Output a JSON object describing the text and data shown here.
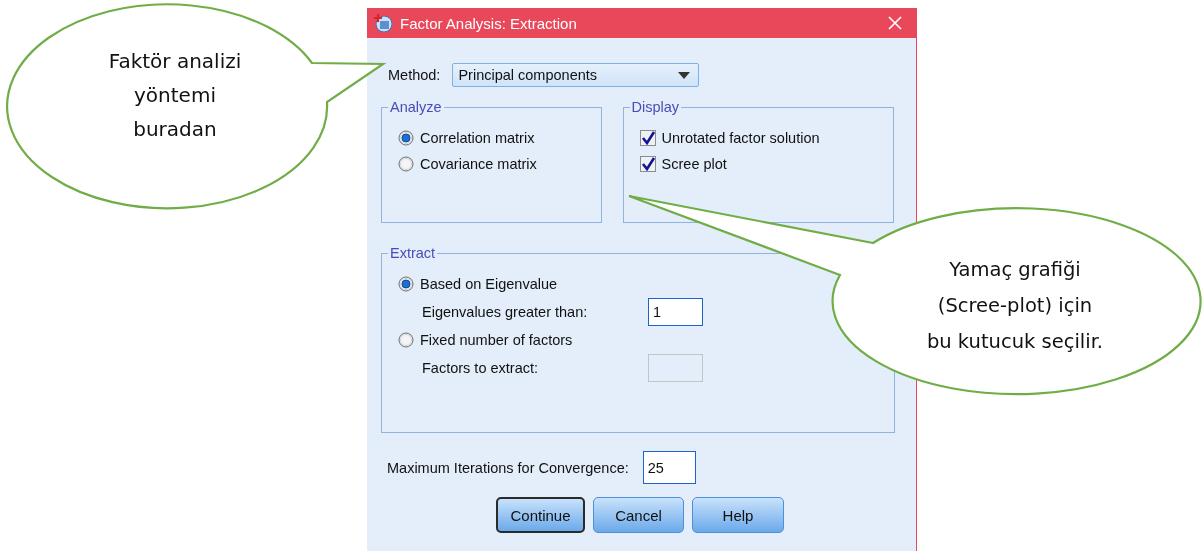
{
  "window": {
    "title": "Factor Analysis: Extraction"
  },
  "method": {
    "label": "Method:",
    "value": "Principal components"
  },
  "analyze": {
    "title": "Analyze",
    "options": [
      {
        "label": "Correlation matrix",
        "selected": true
      },
      {
        "label": "Covariance matrix",
        "selected": false
      }
    ]
  },
  "display": {
    "title": "Display",
    "options": [
      {
        "label": "Unrotated factor solution",
        "checked": true
      },
      {
        "label": "Scree plot",
        "checked": true
      }
    ]
  },
  "extract": {
    "title": "Extract",
    "options": [
      {
        "label": "Based on Eigenvalue",
        "selected": true,
        "field": {
          "label": "Eigenvalues greater than:",
          "value": "1",
          "disabled": false
        }
      },
      {
        "label": "Fixed number of factors",
        "selected": false,
        "field": {
          "label": "Factors to extract:",
          "disabled": true
        }
      }
    ]
  },
  "max_iterations": {
    "label": "Maximum Iterations for Convergence:",
    "value": "25"
  },
  "buttons": [
    {
      "label": "Continue",
      "default": true
    },
    {
      "label": "Cancel",
      "default": false
    },
    {
      "label": "Help",
      "default": false
    }
  ],
  "callouts": [
    {
      "text": "Faktör analizi\nyöntemi\nburadan"
    },
    {
      "text": "Yamaç grafiği\n(Scree-plot) için\nbu kutucuk seçilir."
    }
  ]
}
